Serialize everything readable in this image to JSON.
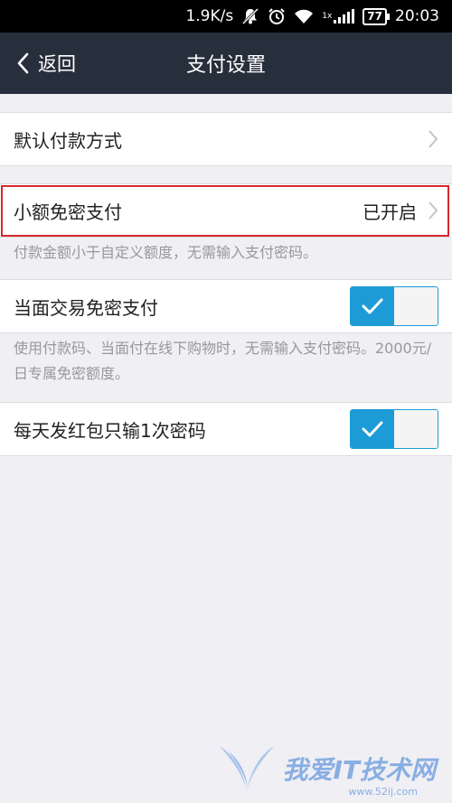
{
  "status_bar": {
    "speed": "1.9K/s",
    "network": "1x",
    "battery": "77",
    "time": "20:03"
  },
  "nav": {
    "back_label": "返回",
    "title": "支付设置"
  },
  "settings": {
    "default_payment": {
      "label": "默认付款方式"
    },
    "small_amount": {
      "label": "小额免密支付",
      "value": "已开启",
      "hint": "付款金额小于自定义额度，无需输入支付密码。"
    },
    "face_to_face": {
      "label": "当面交易免密支付",
      "enabled": true,
      "hint": "使用付款码、当面付在线下购物时，无需输入支付密码。2000元/日专属免密额度。"
    },
    "red_packet": {
      "label": "每天发红包只输1次密码",
      "enabled": true
    }
  },
  "watermark": {
    "text": "我爱IT技术网",
    "url": "www.52ij.com"
  },
  "colors": {
    "nav_bg": "#282f3c",
    "toggle_on": "#1d9bd7",
    "highlight": "#d9272e",
    "page_bg": "#efeff4"
  }
}
